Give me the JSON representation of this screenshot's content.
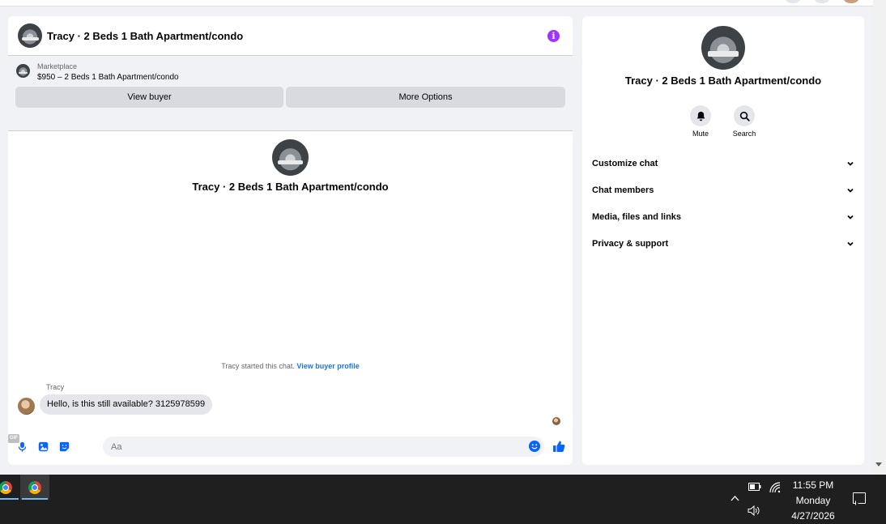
{
  "chat": {
    "title": "Tracy · 2 Beds 1 Bath Apartment/condo",
    "info_icon": "i"
  },
  "listing": {
    "label": "Marketplace",
    "price_line": "$950 – 2 Beds 1 Bath Apartment/condo",
    "view_buyer_label": "View buyer",
    "more_options_label": "More Options"
  },
  "thread": {
    "title": "Tracy · 2 Beds 1 Bath Apartment/condo",
    "started_text": "Tracy started this chat.",
    "started_link": "View buyer profile",
    "sender_name": "Tracy",
    "message": "Hello, is this still available? 3125978599"
  },
  "composer": {
    "placeholder": "Aa",
    "gif_label": "GIF"
  },
  "side": {
    "title": "Tracy · 2 Beds 1 Bath Apartment/condo",
    "mute_label": "Mute",
    "search_label": "Search",
    "sections": [
      {
        "label": "Customize chat"
      },
      {
        "label": "Chat members"
      },
      {
        "label": "Media, files and links"
      },
      {
        "label": "Privacy & support"
      }
    ]
  },
  "taskbar": {
    "time": "11:55 PM",
    "day": "Monday",
    "date": "4/27/2026"
  },
  "colors": {
    "accent": "#0866ff",
    "info": "#a033ff",
    "link": "#1b74e4"
  }
}
